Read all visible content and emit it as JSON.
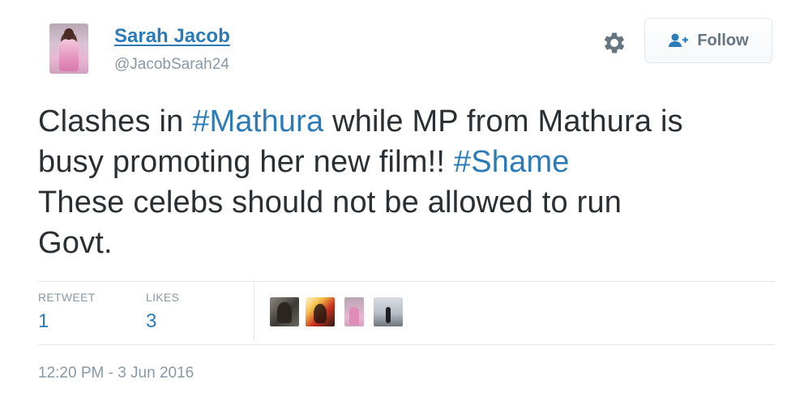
{
  "user": {
    "name": "Sarah Jacob",
    "handle": "@JacobSarah24",
    "avatar_icon": "profile-photo"
  },
  "actions": {
    "settings_icon": "gear-icon",
    "follow_label": "Follow",
    "follow_icon": "add-user-icon"
  },
  "tweet": {
    "line1_pre": "Clashes in ",
    "line1_hashtag": "#Mathura",
    "line1_post": " while MP from Mathura is",
    "line2_pre": "busy promoting her new film!! ",
    "line2_hashtag": "#Shame",
    "line3": "These celebs should not be allowed to run",
    "line4": "Govt."
  },
  "stats": {
    "retweet_label": "RETWEET",
    "retweet_count": "1",
    "likes_label": "LIKES",
    "likes_count": "3"
  },
  "timestamp": "12:20 PM - 3 Jun 2016",
  "colors": {
    "link": "#2b7bb9",
    "muted": "#8899a6",
    "text": "#292f33",
    "border": "#e1e8ed"
  }
}
